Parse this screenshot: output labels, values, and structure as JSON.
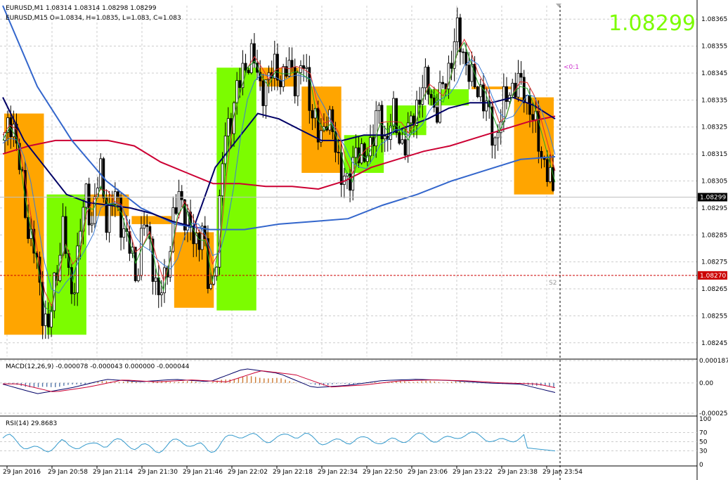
{
  "main": {
    "symbol_line": "EURUSD,M1  1.08314 1.08314 1.08298 1.08299",
    "htf_line": "EURUSD,M15   O=1.0834,  H=1.0835,  L=1.083,  C=1.083",
    "big_price": "1.08299",
    "current_price_label": "1.08299",
    "s2_price_label": "1.08270",
    "s2_text": "S2",
    "marker_text": "<0:1",
    "price_ticks": [
      "1.08365",
      "1.08355",
      "1.08345",
      "1.08335",
      "1.08325",
      "1.08315",
      "1.08305",
      "1.08295",
      "1.08285",
      "1.08275",
      "1.08265",
      "1.08255",
      "1.08245"
    ]
  },
  "macd": {
    "label": "MACD(12,26,9) -0.000078 -0.000043 0.000000 -0.000044",
    "ticks": [
      "0.000187",
      "0.00",
      "-0.000253"
    ]
  },
  "rsi": {
    "label": "RSI(14) 29.8683",
    "ticks": [
      "100",
      "70",
      "50",
      "30",
      "0"
    ]
  },
  "time_ticks": [
    "29 Jan 2016",
    "29 Jan 20:58",
    "29 Jan 21:14",
    "29 Jan 21:30",
    "29 Jan 21:46",
    "29 Jan 22:02",
    "29 Jan 22:18",
    "29 Jan 22:34",
    "29 Jan 22:50",
    "29 Jan 23:06",
    "29 Jan 23:22",
    "29 Jan 23:38",
    "29 Jan 23:54"
  ],
  "colors": {
    "bull_box": "#7cfc00",
    "bear_box": "#ffa500",
    "ma_dark": "#000066",
    "ma_blue": "#3366cc",
    "ma_red": "#cc0033",
    "big_price": "#7cfc00",
    "s2_line": "#cc0000",
    "rsi_line": "#3399cc"
  },
  "chart_data": {
    "type": "candlestick",
    "symbol": "EURUSD",
    "timeframe": "M1",
    "ylim": [
      1.0824,
      1.0837
    ],
    "last_price": 1.08299,
    "s2_level": 1.0827,
    "m15_boxes": [
      {
        "dir": "bear",
        "open": 1.0833,
        "close": 1.08248
      },
      {
        "dir": "bull",
        "open": 1.08248,
        "close": 1.083
      },
      {
        "dir": "bear",
        "open": 1.083,
        "close": 1.08292
      },
      {
        "dir": "bear",
        "open": 1.08292,
        "close": 1.08289
      },
      {
        "dir": "bear",
        "open": 1.08286,
        "close": 1.08258
      },
      {
        "dir": "bull",
        "open": 1.08257,
        "close": 1.08347
      },
      {
        "dir": "bear",
        "open": 1.08347,
        "close": 1.0834
      },
      {
        "dir": "bear",
        "open": 1.0834,
        "close": 1.08308
      },
      {
        "dir": "bull",
        "open": 1.08308,
        "close": 1.08322
      },
      {
        "dir": "bull",
        "open": 1.08322,
        "close": 1.08333
      },
      {
        "dir": "bull",
        "open": 1.08333,
        "close": 1.08339
      },
      {
        "dir": "bear",
        "open": 1.0834,
        "close": 1.08339
      },
      {
        "dir": "bear",
        "open": 1.08336,
        "close": 1.083
      }
    ],
    "close_path": [
      1.0832,
      1.0833,
      1.0831,
      1.0829,
      1.0828,
      1.0826,
      1.0825,
      1.0827,
      1.0829,
      1.0826,
      1.0828,
      1.083,
      1.0829,
      1.0831,
      1.0829,
      1.083,
      1.0829,
      1.0828,
      1.0827,
      1.0829,
      1.0828,
      1.0826,
      1.0827,
      1.0829,
      1.083,
      1.0829,
      1.0828,
      1.0829,
      1.0826,
      1.0828,
      1.0832,
      1.0833,
      1.0834,
      1.0835,
      1.0835,
      1.0834,
      1.0834,
      1.0835,
      1.0834,
      1.0835,
      1.0834,
      1.0835,
      1.0833,
      1.0832,
      1.0833,
      1.0832,
      1.0831,
      1.083,
      1.0832,
      1.0831,
      1.0832,
      1.0833,
      1.0832,
      1.0833,
      1.0832,
      1.0832,
      1.0833,
      1.0834,
      1.0834,
      1.0833,
      1.0834,
      1.0835,
      1.0836,
      1.0835,
      1.0834,
      1.0834,
      1.0833,
      1.0832,
      1.0833,
      1.0834,
      1.0834,
      1.0834,
      1.0833,
      1.0832,
      1.0831,
      1.083
    ],
    "ma_dark": [
      1.08336,
      1.0832,
      1.0831,
      1.083,
      1.08297,
      1.08296,
      1.08295,
      1.08293,
      1.0829,
      1.08288,
      1.0831,
      1.0832,
      1.0833,
      1.08328,
      1.08324,
      1.0832,
      1.0832,
      1.08322,
      1.08322,
      1.08325,
      1.08328,
      1.08332,
      1.08334,
      1.08334,
      1.08336,
      1.08333,
      1.08328
    ],
    "ma_red": [
      1.08315,
      1.08318,
      1.0832,
      1.0832,
      1.0832,
      1.08318,
      1.08312,
      1.08308,
      1.08304,
      1.08304,
      1.08303,
      1.08303,
      1.08302,
      1.08305,
      1.0831,
      1.08313,
      1.08316,
      1.08318,
      1.08321,
      1.08324,
      1.08327,
      1.08329
    ],
    "ma_blue": [
      1.0837,
      1.0834,
      1.0832,
      1.08305,
      1.08295,
      1.08289,
      1.08287,
      1.08287,
      1.08289,
      1.0829,
      1.08291,
      1.08296,
      1.083,
      1.08305,
      1.08309,
      1.08313,
      1.08314
    ],
    "macd_values": [
      -1e-05,
      -9e-05,
      -4e-05,
      3e-05,
      1e-05,
      3e-05,
      1e-05,
      0.00012,
      8e-05,
      -4e-05,
      -2e-05,
      2e-05,
      3e-05,
      2e-05,
      0.0,
      -1e-05,
      -8e-05
    ],
    "rsi_last": 29.8683,
    "rsi_levels": [
      70,
      50,
      30
    ]
  }
}
